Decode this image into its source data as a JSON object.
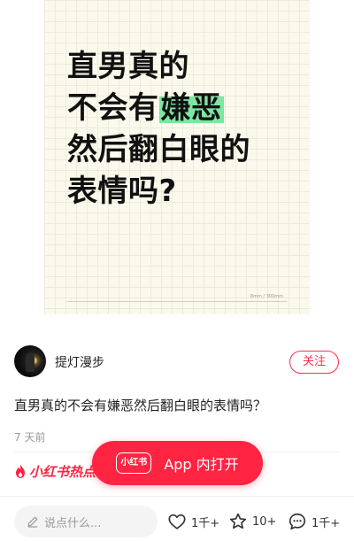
{
  "cover": {
    "lines": [
      "直男真的",
      "不会有",
      "嫌恶",
      "然后翻白眼的",
      "表情吗?"
    ],
    "meta": "8mm / 300mm",
    "highlight_color": "#7ee5a3"
  },
  "author": {
    "name": "提灯漫步"
  },
  "follow_label": "关注",
  "post": {
    "title": "直男真的不会有嫌恶然后翻白眼的表情吗？",
    "time": "7 天前"
  },
  "brand": {
    "text": "小红书热点"
  },
  "open_app": {
    "logo": "小红书",
    "label": "App 内打开"
  },
  "comment": {
    "placeholder": "说点什么..."
  },
  "actions": {
    "like": {
      "count": "1千+",
      "icon": "heart-icon"
    },
    "favorite": {
      "count": "10+",
      "icon": "star-icon"
    },
    "comment": {
      "count": "1千+",
      "icon": "comment-icon"
    }
  },
  "colors": {
    "accent": "#ff2442",
    "text": "#222222",
    "muted": "#999999"
  }
}
